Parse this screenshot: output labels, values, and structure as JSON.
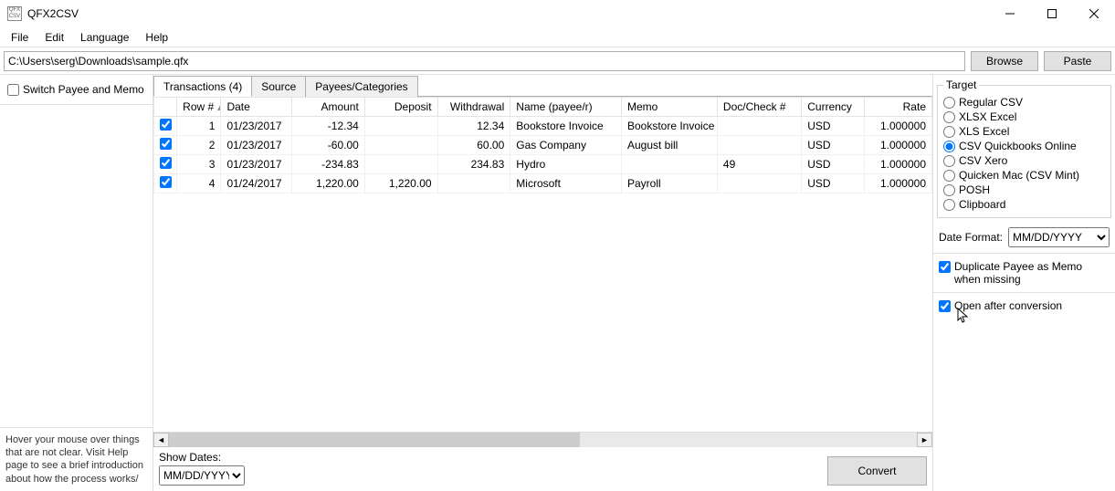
{
  "window": {
    "title": "QFX2CSV",
    "logo": "QFX CSV"
  },
  "menus": [
    "File",
    "Edit",
    "Language",
    "Help"
  ],
  "path": {
    "value": "C:\\Users\\serg\\Downloads\\sample.qfx"
  },
  "buttons": {
    "browse": "Browse",
    "paste": "Paste",
    "convert": "Convert"
  },
  "left": {
    "switch_label": "Switch Payee and Memo",
    "switch_checked": false,
    "help_text": "Hover your mouse over things that are not clear. Visit Help page to see a brief introduction about how the process works/"
  },
  "tabs": [
    {
      "label": "Transactions (4)",
      "active": true
    },
    {
      "label": "Source",
      "active": false
    },
    {
      "label": "Payees/Categories",
      "active": false
    }
  ],
  "table": {
    "columns": [
      "",
      "Row #",
      "Date",
      "Amount",
      "Deposit",
      "Withdrawal",
      "Name (payee/r)",
      "Memo",
      "Doc/Check #",
      "Currency",
      "Rate"
    ],
    "sort_col": 1,
    "rows": [
      {
        "checked": true,
        "rownum": "1",
        "date": "01/23/2017",
        "amount": "-12.34",
        "deposit": "",
        "withdrawal": "12.34",
        "name": "Bookstore Invoice",
        "memo": "Bookstore Invoice",
        "doc": "",
        "currency": "USD",
        "rate": "1.000000"
      },
      {
        "checked": true,
        "rownum": "2",
        "date": "01/23/2017",
        "amount": "-60.00",
        "deposit": "",
        "withdrawal": "60.00",
        "name": "Gas Company",
        "memo": "August bill",
        "doc": "",
        "currency": "USD",
        "rate": "1.000000"
      },
      {
        "checked": true,
        "rownum": "3",
        "date": "01/23/2017",
        "amount": "-234.83",
        "deposit": "",
        "withdrawal": "234.83",
        "name": "Hydro",
        "memo": "",
        "doc": "49",
        "currency": "USD",
        "rate": "1.000000"
      },
      {
        "checked": true,
        "rownum": "4",
        "date": "01/24/2017",
        "amount": "1,220.00",
        "deposit": "1,220.00",
        "withdrawal": "",
        "name": "Microsoft",
        "memo": "Payroll",
        "doc": "",
        "currency": "USD",
        "rate": "1.000000"
      }
    ]
  },
  "show_dates": {
    "label": "Show Dates:",
    "value": "MM/DD/YYYY"
  },
  "target": {
    "legend": "Target",
    "options": [
      "Regular CSV",
      "XLSX Excel",
      "XLS Excel",
      "CSV Quickbooks Online",
      "CSV Xero",
      "Quicken Mac (CSV Mint)",
      "POSH",
      "Clipboard"
    ],
    "selected": 3
  },
  "date_format": {
    "label": "Date Format:",
    "value": "MM/DD/YYYY"
  },
  "options": {
    "dup_label": "Duplicate Payee as Memo when missing",
    "dup_checked": true,
    "open_label": "Open after conversion",
    "open_checked": true
  }
}
